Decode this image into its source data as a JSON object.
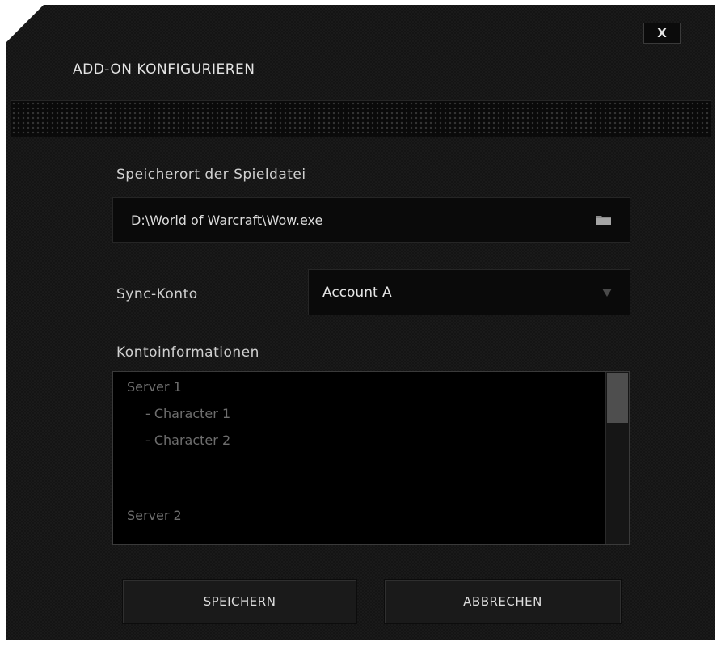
{
  "dialog": {
    "title": "ADD-ON KONFIGURIEREN",
    "close_label": "X"
  },
  "game_file": {
    "label": "Speicherort der Spieldatei",
    "value": "D:\\World of Warcraft\\Wow.exe",
    "browse_icon": "folder-icon"
  },
  "sync_account": {
    "label": "Sync-Konto",
    "selected": "Account A",
    "dropdown_icon": "chevron-down-icon"
  },
  "account_info": {
    "label": "Kontoinformationen",
    "items": [
      {
        "text": "Server 1"
      },
      {
        "text": "- Character 1"
      },
      {
        "text": "- Character 2"
      },
      {
        "text": "Server 2"
      }
    ]
  },
  "buttons": {
    "save": "SPEICHERN",
    "cancel": "ABBRECHEN"
  },
  "colors": {
    "background": "#141414",
    "field": "#0a0a0a",
    "text": "#dcdcdc",
    "muted_text": "#6e6e6e"
  }
}
